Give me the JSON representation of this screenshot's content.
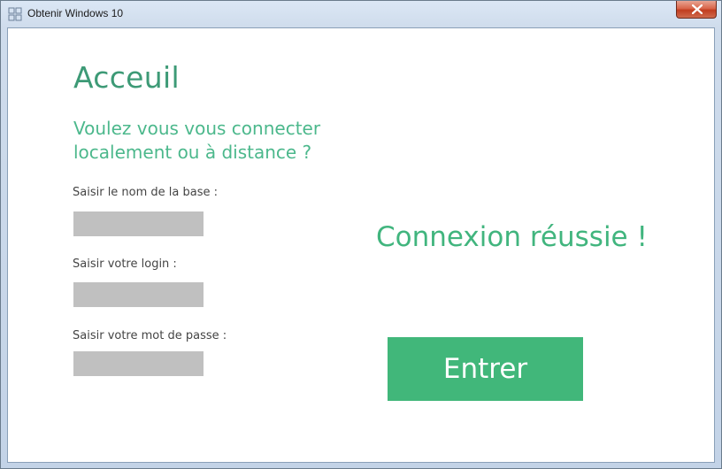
{
  "window": {
    "title": "Obtenir Windows 10",
    "close_icon": "close-icon",
    "app_icon": "windows-logo-icon"
  },
  "home": {
    "heading": "Acceuil",
    "question_line1": "Voulez vous vous connecter",
    "question_line2": "localement ou à distance ?",
    "fields": [
      {
        "label": "Saisir le nom de la base :",
        "value": "",
        "placeholder": ""
      },
      {
        "label": "Saisir votre login :",
        "value": "",
        "placeholder": ""
      },
      {
        "label": "Saisir votre mot de passe :",
        "value": "",
        "placeholder": ""
      }
    ],
    "status": "Connexion réussie !",
    "enter_label": "Entrer"
  },
  "colors": {
    "accent": "#41b77a",
    "heading": "#3d9a76",
    "input_bg": "#c0c0c0",
    "close_button": "#c94a2c"
  }
}
